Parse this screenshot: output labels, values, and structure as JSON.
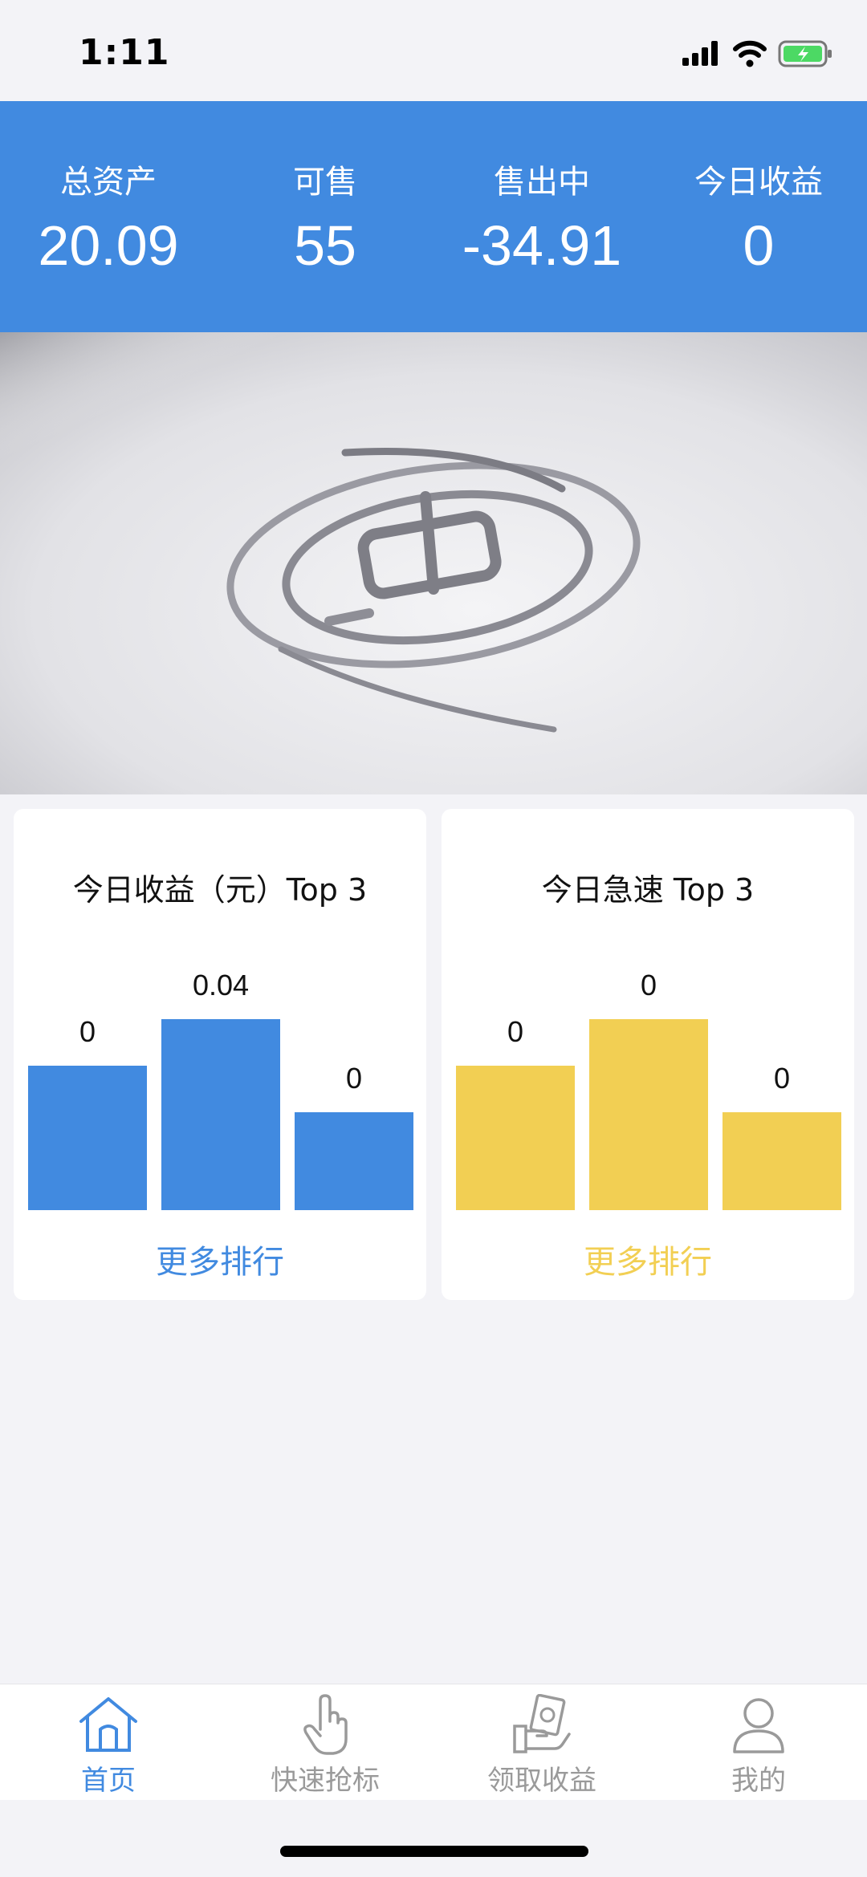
{
  "status_bar": {
    "time": "1:11"
  },
  "header": {
    "stats": [
      {
        "label": "总资产",
        "value": "20.09"
      },
      {
        "label": "可售",
        "value": "55"
      },
      {
        "label": "售出中",
        "value": "-34.91"
      },
      {
        "label": "今日收益",
        "value": "0"
      }
    ],
    "background_color": "#418ae0"
  },
  "cards": [
    {
      "title": "今日收益（元）Top 3",
      "more_label": "更多排行",
      "color": "#418ae0"
    },
    {
      "title": "今日急速 Top 3",
      "more_label": "更多排行",
      "color": "#f2cf53"
    }
  ],
  "chart_data": [
    {
      "type": "bar",
      "title": "今日收益（元）Top 3",
      "categories": [
        "",
        "",
        ""
      ],
      "values": [
        0,
        0.04,
        0
      ],
      "value_labels": [
        "0",
        "0.04",
        "0"
      ],
      "color": "#418ae0"
    },
    {
      "type": "bar",
      "title": "今日急速 Top 3",
      "categories": [
        "",
        "",
        ""
      ],
      "values": [
        0,
        0,
        0
      ],
      "value_labels": [
        "0",
        "0",
        "0"
      ],
      "color": "#f2cf53"
    }
  ],
  "tabbar": {
    "items": [
      {
        "label": "首页",
        "icon": "home-icon",
        "active": true
      },
      {
        "label": "快速抢标",
        "icon": "hand-pointer-icon",
        "active": false
      },
      {
        "label": "领取收益",
        "icon": "cash-hand-icon",
        "active": false
      },
      {
        "label": "我的",
        "icon": "user-icon",
        "active": false
      }
    ],
    "active_color": "#418ae0",
    "inactive_color": "#9a9a9a"
  }
}
